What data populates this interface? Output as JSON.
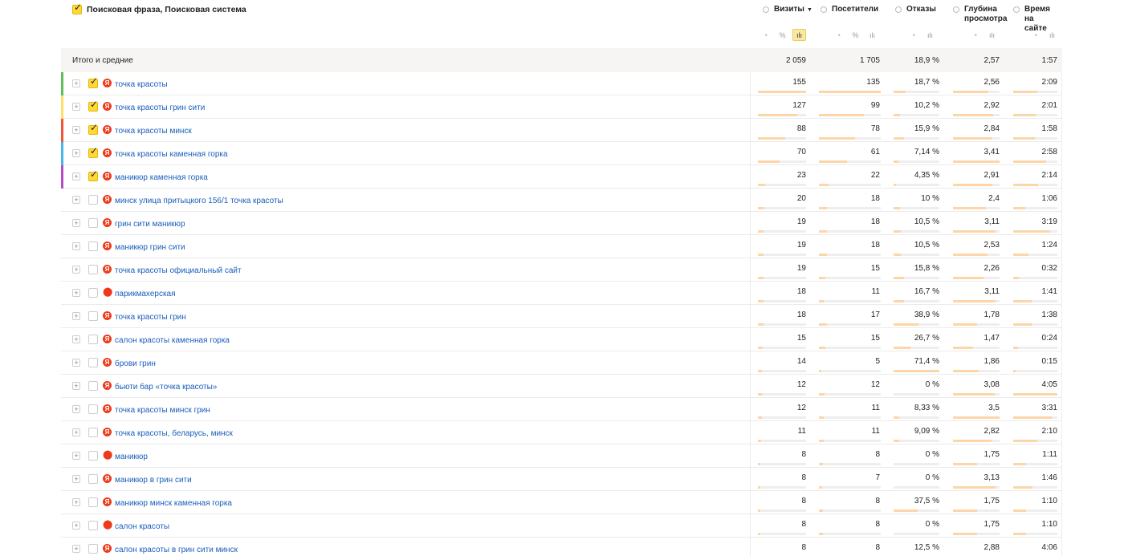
{
  "header": {
    "title": "Поисковая фраза, Поисковая система",
    "metrics": [
      {
        "label": "Визиты",
        "sorted": true,
        "sort_arrow": "▼"
      },
      {
        "label": "Посетители",
        "sorted": false
      },
      {
        "label": "Отказы",
        "sorted": false
      },
      {
        "label": "Глубина просмотра",
        "sorted": false
      },
      {
        "label": "Время на сайте",
        "sorted": false
      }
    ],
    "icons": {
      "pie": "◔",
      "percent": "%",
      "bars": "ılı"
    }
  },
  "total": {
    "label": "Итого и средние",
    "values": [
      "2 059",
      "1 705",
      "18,9 %",
      "2,57",
      "1:57"
    ]
  },
  "rows": [
    {
      "phrase": "точка красоты",
      "source": "yandex",
      "checked": true,
      "color": "#5fbf5a",
      "values": [
        "155",
        "135",
        "18,7 %",
        "2,56",
        "2:09"
      ],
      "fill": [
        1.0,
        1.0,
        0.26,
        0.75,
        0.54
      ]
    },
    {
      "phrase": "точка красоты грин сити",
      "source": "yandex",
      "checked": true,
      "color": "#ffe066",
      "values": [
        "127",
        "99",
        "10,2 %",
        "2,92",
        "2:01"
      ],
      "fill": [
        0.82,
        0.73,
        0.14,
        0.86,
        0.5
      ]
    },
    {
      "phrase": "точка красоты минск",
      "source": "yandex",
      "checked": true,
      "color": "#f0553a",
      "values": [
        "88",
        "78",
        "15,9 %",
        "2,84",
        "1:58"
      ],
      "fill": [
        0.57,
        0.58,
        0.22,
        0.83,
        0.49
      ]
    },
    {
      "phrase": "точка красоты каменная горка",
      "source": "yandex",
      "checked": true,
      "color": "#4ab4e6",
      "values": [
        "70",
        "61",
        "7,14 %",
        "3,41",
        "2:58"
      ],
      "fill": [
        0.45,
        0.45,
        0.1,
        1.0,
        0.74
      ]
    },
    {
      "phrase": "маникюр каменная горка",
      "source": "yandex",
      "checked": true,
      "color": "#b34fc6",
      "values": [
        "23",
        "22",
        "4,35 %",
        "2,91",
        "2:14"
      ],
      "fill": [
        0.15,
        0.16,
        0.06,
        0.85,
        0.56
      ]
    },
    {
      "phrase": "минск улица притыцкого 156/1 точка красоты",
      "source": "yandex",
      "checked": false,
      "color": "",
      "values": [
        "20",
        "18",
        "10 %",
        "2,4",
        "1:06"
      ],
      "fill": [
        0.13,
        0.13,
        0.14,
        0.7,
        0.27
      ]
    },
    {
      "phrase": "грин сити маникюр",
      "source": "yandex",
      "checked": false,
      "color": "",
      "values": [
        "19",
        "18",
        "10,5 %",
        "3,11",
        "3:19"
      ],
      "fill": [
        0.12,
        0.13,
        0.15,
        0.91,
        0.83
      ]
    },
    {
      "phrase": "маникюр грин сити",
      "source": "yandex",
      "checked": false,
      "color": "",
      "values": [
        "19",
        "18",
        "10,5 %",
        "2,53",
        "1:24"
      ],
      "fill": [
        0.12,
        0.13,
        0.15,
        0.74,
        0.35
      ]
    },
    {
      "phrase": "точка красоты официальный сайт",
      "source": "yandex",
      "checked": false,
      "color": "",
      "values": [
        "19",
        "15",
        "15,8 %",
        "2,26",
        "0:32"
      ],
      "fill": [
        0.12,
        0.11,
        0.22,
        0.66,
        0.13
      ]
    },
    {
      "phrase": "парикмахерская",
      "source": "maps",
      "checked": false,
      "color": "",
      "values": [
        "18",
        "11",
        "16,7 %",
        "3,11",
        "1:41"
      ],
      "fill": [
        0.12,
        0.08,
        0.23,
        0.91,
        0.42
      ]
    },
    {
      "phrase": "точка красоты грин",
      "source": "yandex",
      "checked": false,
      "color": "",
      "values": [
        "18",
        "17",
        "38,9 %",
        "1,78",
        "1:38"
      ],
      "fill": [
        0.12,
        0.13,
        0.54,
        0.52,
        0.41
      ]
    },
    {
      "phrase": "салон красоты каменная горка",
      "source": "yandex",
      "checked": false,
      "color": "",
      "values": [
        "15",
        "15",
        "26,7 %",
        "1,47",
        "0:24"
      ],
      "fill": [
        0.1,
        0.11,
        0.37,
        0.43,
        0.1
      ]
    },
    {
      "phrase": "брови грин",
      "source": "yandex",
      "checked": false,
      "color": "",
      "values": [
        "14",
        "5",
        "71,4 %",
        "1,86",
        "0:15"
      ],
      "fill": [
        0.09,
        0.04,
        1.0,
        0.55,
        0.06
      ]
    },
    {
      "phrase": "бьюти бар «точка красоты»",
      "source": "yandex",
      "checked": false,
      "color": "",
      "values": [
        "12",
        "12",
        "0 %",
        "3,08",
        "4:05"
      ],
      "fill": [
        0.08,
        0.09,
        0.0,
        0.9,
        1.0
      ]
    },
    {
      "phrase": "точка красоты минск грин",
      "source": "yandex",
      "checked": false,
      "color": "",
      "values": [
        "12",
        "11",
        "8,33 %",
        "3,5",
        "3:31"
      ],
      "fill": [
        0.08,
        0.08,
        0.12,
        1.0,
        0.88
      ]
    },
    {
      "phrase": "точка красоты, беларусь, минск",
      "source": "yandex",
      "checked": false,
      "color": "",
      "values": [
        "11",
        "11",
        "9,09 %",
        "2,82",
        "2:10"
      ],
      "fill": [
        0.07,
        0.08,
        0.13,
        0.83,
        0.54
      ]
    },
    {
      "phrase": "маникюр",
      "source": "maps",
      "checked": false,
      "color": "",
      "values": [
        "8",
        "8",
        "0 %",
        "1,75",
        "1:11"
      ],
      "fill": [
        0.05,
        0.06,
        0.0,
        0.51,
        0.29
      ]
    },
    {
      "phrase": "маникюр в грин сити",
      "source": "yandex",
      "checked": false,
      "color": "",
      "values": [
        "8",
        "7",
        "0 %",
        "3,13",
        "1:46"
      ],
      "fill": [
        0.05,
        0.05,
        0.0,
        0.92,
        0.44
      ]
    },
    {
      "phrase": "маникюр минск каменная горка",
      "source": "yandex",
      "checked": false,
      "color": "",
      "values": [
        "8",
        "8",
        "37,5 %",
        "1,75",
        "1:10"
      ],
      "fill": [
        0.05,
        0.06,
        0.52,
        0.51,
        0.29
      ]
    },
    {
      "phrase": "салон красоты",
      "source": "maps",
      "checked": false,
      "color": "",
      "values": [
        "8",
        "8",
        "0 %",
        "1,75",
        "1:10"
      ],
      "fill": [
        0.05,
        0.06,
        0.0,
        0.51,
        0.29
      ]
    },
    {
      "phrase": "салон красоты в грин сити минск",
      "source": "yandex",
      "checked": false,
      "color": "",
      "values": [
        "8",
        "8",
        "12,5 %",
        "2,88",
        "4:06"
      ],
      "fill": [
        0.05,
        0.06,
        0.18,
        0.85,
        1.0
      ]
    }
  ],
  "source_icons": {
    "yandex": "Я",
    "maps": "⬤"
  }
}
